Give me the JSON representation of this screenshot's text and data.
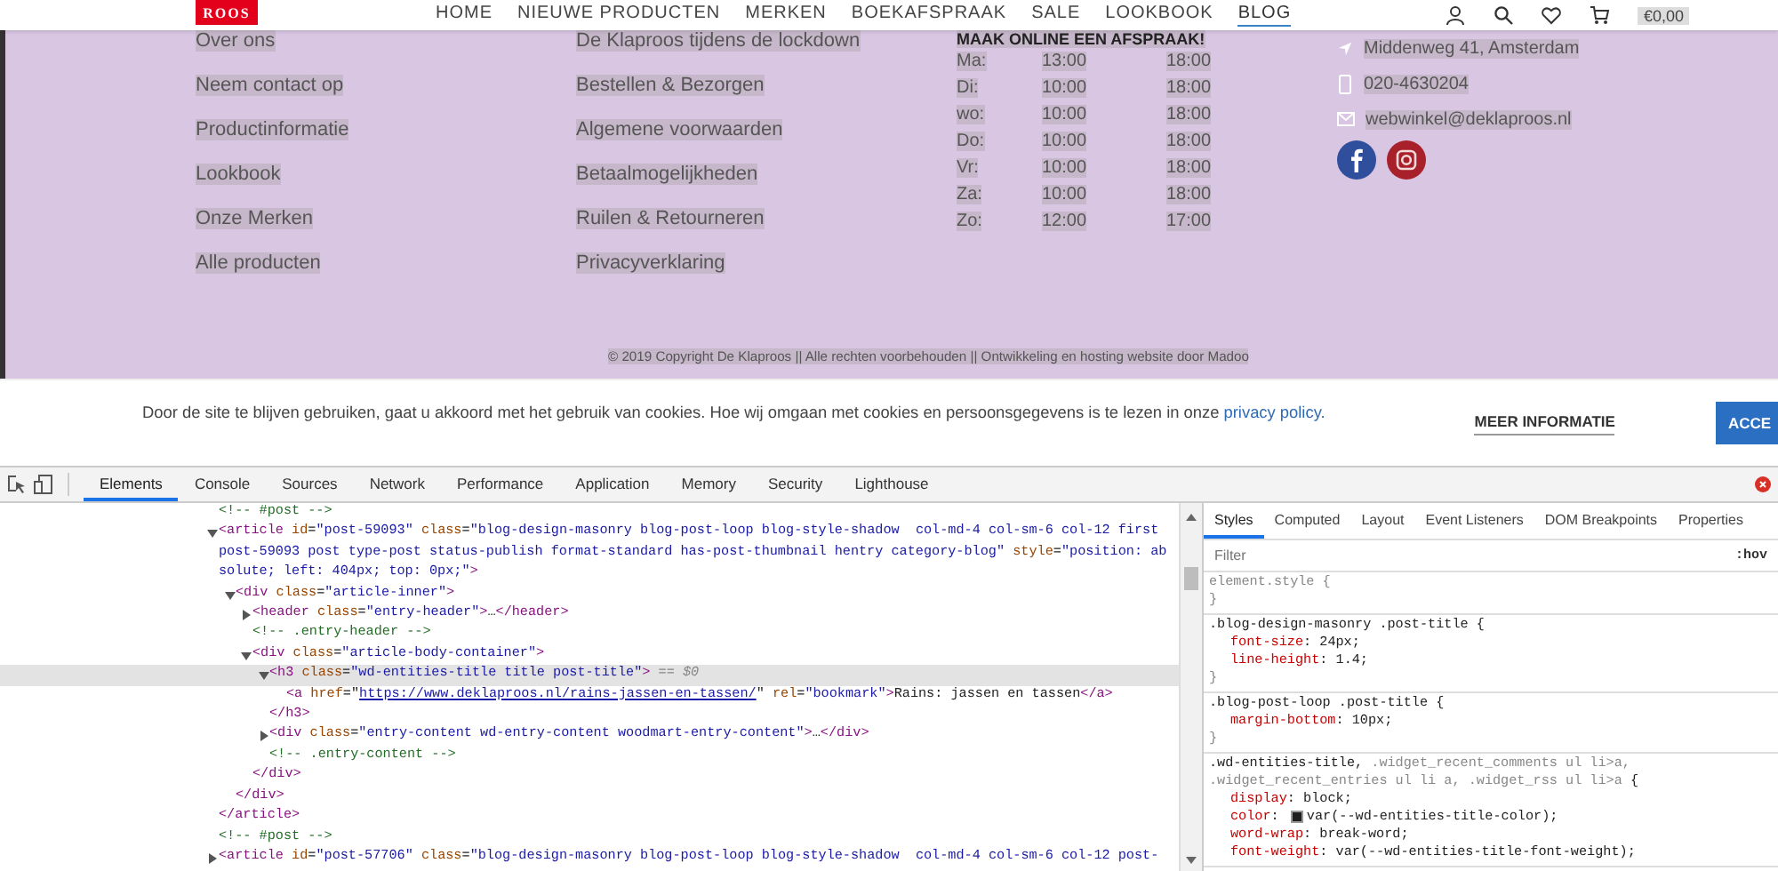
{
  "header": {
    "logo": "ROOS",
    "nav": [
      {
        "label": "HOME",
        "selected": false
      },
      {
        "label": "NIEUWE PRODUCTEN",
        "selected": false
      },
      {
        "label": "MERKEN",
        "selected": false
      },
      {
        "label": "BOEKAFSPRAAK",
        "selected": false
      },
      {
        "label": "SALE",
        "selected": false
      },
      {
        "label": "LOOKBOOK",
        "selected": false
      },
      {
        "label": "BLOG",
        "selected": true
      }
    ],
    "cart_total": "€0,00"
  },
  "footer": {
    "links_1": [
      "Over ons",
      "Neem contact op",
      "Productinformatie",
      "Lookbook",
      "Onze Merken",
      "Alle producten"
    ],
    "links_2": [
      "De Klaproos tijdens de lockdown",
      "Bestellen & Bezorgen",
      "Algemene voorwaarden",
      "Betaalmogelijkheden",
      "Ruilen & Retourneren",
      "Privacyverklaring"
    ],
    "hours": {
      "title": "MAAK ONLINE EEN AFSPRAAK!",
      "rows": [
        {
          "day": "Ma:",
          "open": "13:00",
          "close": "18:00"
        },
        {
          "day": "Di:",
          "open": "10:00",
          "close": "18:00"
        },
        {
          "day": "wo:",
          "open": "10:00",
          "close": "18:00"
        },
        {
          "day": "Do:",
          "open": "10:00",
          "close": "18:00"
        },
        {
          "day": "Vr:",
          "open": "10:00",
          "close": "18:00"
        },
        {
          "day": "Za:",
          "open": "10:00",
          "close": "18:00"
        },
        {
          "day": "Zo:",
          "open": "12:00",
          "close": "17:00"
        }
      ]
    },
    "contact": [
      {
        "kind": "address",
        "text": "Middenweg 41, Amsterdam"
      },
      {
        "kind": "phone",
        "text": "020-4630204"
      },
      {
        "kind": "email",
        "text": "webwinkel@deklaproos.nl"
      }
    ],
    "social": [
      {
        "kind": "facebook"
      },
      {
        "kind": "instagram"
      }
    ],
    "copyright": "© 2019 Copyright De Klaproos || Alle rechten voorbehouden || Ontwikkeling en hosting website door Madoo"
  },
  "cookie_bar": {
    "text": "Door de site te blijven gebruiken, gaat u akkoord met het gebruik van cookies. Hoe wij omgaan met cookies en persoonsgegevens is te lezen in onze ",
    "link": "privacy policy.",
    "more_button": "MEER INFORMATIE",
    "accept_button": "ACCE"
  },
  "devtools": {
    "tabs": [
      {
        "label": "Elements",
        "selected": true
      },
      {
        "label": "Console",
        "selected": false
      },
      {
        "label": "Sources",
        "selected": false
      },
      {
        "label": "Network",
        "selected": false
      },
      {
        "label": "Performance",
        "selected": false
      },
      {
        "label": "Application",
        "selected": false
      },
      {
        "label": "Memory",
        "selected": false
      },
      {
        "label": "Security",
        "selected": false
      },
      {
        "label": "Lighthouse",
        "selected": false
      }
    ],
    "elements": {
      "nodes": [
        {
          "selected": false,
          "tokens": [
            {
              "kind": "comment",
              "text": "<!-- #post -->"
            }
          ]
        },
        {
          "selected": false,
          "expanded": true,
          "tokens": [
            {
              "kind": "tag",
              "text": "<article "
            },
            {
              "kind": "attr",
              "text": "id"
            },
            {
              "kind": "text",
              "text": "="
            },
            {
              "kind": "value",
              "text": "\"post-59093\" "
            },
            {
              "kind": "attr",
              "text": "class"
            },
            {
              "kind": "text",
              "text": "="
            },
            {
              "kind": "value",
              "text": "\"blog-design-masonry blog-post-loop blog-style-shadow  col-md-4 col-sm-6 col-12 first post-59093 post type-post status-publish format-standard has-post-thumbnail hentry category-blog\" "
            },
            {
              "kind": "attr",
              "text": "style"
            },
            {
              "kind": "text",
              "text": "="
            },
            {
              "kind": "value",
              "text": "\"position: absolute; left: 404px; top: 0px;\""
            },
            {
              "kind": "tag",
              "text": ">"
            }
          ],
          "children": [
            {
              "selected": false,
              "expanded": true,
              "tokens": [
                {
                  "kind": "tag",
                  "text": "<div "
                },
                {
                  "kind": "attr",
                  "text": "class"
                },
                {
                  "kind": "text",
                  "text": "="
                },
                {
                  "kind": "value",
                  "text": "\"article-inner\""
                },
                {
                  "kind": "tag",
                  "text": ">"
                }
              ],
              "children": [
                {
                  "selected": false,
                  "expanded": false,
                  "tokens": [
                    {
                      "kind": "tag",
                      "text": "<header "
                    },
                    {
                      "kind": "attr",
                      "text": "class"
                    },
                    {
                      "kind": "text",
                      "text": "="
                    },
                    {
                      "kind": "value",
                      "text": "\"entry-header\""
                    },
                    {
                      "kind": "tag",
                      "text": ">"
                    },
                    {
                      "kind": "text",
                      "text": "…"
                    },
                    {
                      "kind": "tag",
                      "text": "</header>"
                    }
                  ]
                },
                {
                  "selected": false,
                  "tokens": [
                    {
                      "kind": "comment",
                      "text": "<!-- .entry-header -->"
                    }
                  ]
                },
                {
                  "selected": false,
                  "expanded": true,
                  "tokens": [
                    {
                      "kind": "tag",
                      "text": "<div "
                    },
                    {
                      "kind": "attr",
                      "text": "class"
                    },
                    {
                      "kind": "text",
                      "text": "="
                    },
                    {
                      "kind": "value",
                      "text": "\"article-body-container\""
                    },
                    {
                      "kind": "tag",
                      "text": ">"
                    }
                  ],
                  "children": [
                    {
                      "selected": true,
                      "expanded": true,
                      "tokens": [
                        {
                          "kind": "tag",
                          "text": "<h3 "
                        },
                        {
                          "kind": "attr",
                          "text": "class"
                        },
                        {
                          "kind": "text",
                          "text": "="
                        },
                        {
                          "kind": "value",
                          "text": "\"wd-entities-title title post-title\""
                        },
                        {
                          "kind": "tag",
                          "text": ">"
                        },
                        {
                          "kind": "muted",
                          "text": " == $0"
                        }
                      ],
                      "children": [
                        {
                          "selected": false,
                          "tokens": [
                            {
                              "kind": "tag",
                              "text": "<a "
                            },
                            {
                              "kind": "attr",
                              "text": "href"
                            },
                            {
                              "kind": "text",
                              "text": "=\""
                            },
                            {
                              "kind": "link",
                              "text": "https://www.deklaproos.nl/rains-jassen-en-tassen/"
                            },
                            {
                              "kind": "text",
                              "text": "\" "
                            },
                            {
                              "kind": "attr",
                              "text": "rel"
                            },
                            {
                              "kind": "text",
                              "text": "="
                            },
                            {
                              "kind": "value",
                              "text": "\"bookmark\""
                            },
                            {
                              "kind": "tag",
                              "text": ">"
                            },
                            {
                              "kind": "text",
                              "text": "Rains: jassen en tassen"
                            },
                            {
                              "kind": "tag",
                              "text": "</a>"
                            }
                          ]
                        }
                      ],
                      "close": [
                        {
                          "kind": "tag",
                          "text": "</h3>"
                        }
                      ]
                    },
                    {
                      "selected": false,
                      "expanded": false,
                      "tokens": [
                        {
                          "kind": "tag",
                          "text": "<div "
                        },
                        {
                          "kind": "attr",
                          "text": "class"
                        },
                        {
                          "kind": "text",
                          "text": "="
                        },
                        {
                          "kind": "value",
                          "text": "\"entry-content wd-entry-content woodmart-entry-content\""
                        },
                        {
                          "kind": "tag",
                          "text": ">"
                        },
                        {
                          "kind": "text",
                          "text": "…"
                        },
                        {
                          "kind": "tag",
                          "text": "</div>"
                        }
                      ]
                    },
                    {
                      "selected": false,
                      "tokens": [
                        {
                          "kind": "comment",
                          "text": "<!-- .entry-content -->"
                        }
                      ]
                    }
                  ],
                  "close": [
                    {
                      "kind": "tag",
                      "text": "</div>"
                    }
                  ]
                }
              ],
              "close": [
                {
                  "kind": "tag",
                  "text": "</div>"
                }
              ]
            }
          ],
          "close": [
            {
              "kind": "tag",
              "text": "</article>"
            }
          ]
        },
        {
          "selected": false,
          "tokens": [
            {
              "kind": "comment",
              "text": "<!-- #post -->"
            }
          ]
        },
        {
          "selected": false,
          "expanded": false,
          "tokens": [
            {
              "kind": "tag",
              "text": "<article "
            },
            {
              "kind": "attr",
              "text": "id"
            },
            {
              "kind": "text",
              "text": "="
            },
            {
              "kind": "value",
              "text": "\"post-57706\" "
            },
            {
              "kind": "attr",
              "text": "class"
            },
            {
              "kind": "text",
              "text": "="
            },
            {
              "kind": "value",
              "text": "\"blog-design-masonry blog-post-loop blog-style-shadow  col-md-4 col-sm-6 col-12 post-"
            }
          ]
        }
      ]
    },
    "styles": {
      "tabs": [
        {
          "label": "Styles",
          "selected": true
        },
        {
          "label": "Computed",
          "selected": false
        },
        {
          "label": "Layout",
          "selected": false
        },
        {
          "label": "Event Listeners",
          "selected": false
        },
        {
          "label": "DOM Breakpoints",
          "selected": false
        },
        {
          "label": "Properties",
          "selected": false
        }
      ],
      "filter": {
        "placeholder": "Filter"
      },
      "hov": ":hov",
      "rules": [
        {
          "selector_lines": [
            [
              {
                "kind": "plain",
                "text": "element.style {"
              }
            ]
          ],
          "close": "}"
        },
        {
          "selector_lines": [
            [
              {
                "kind": "match",
                "text": ".blog-design-masonry .post-title {"
              }
            ]
          ],
          "declarations": [
            {
              "name": "font-size",
              "colon": ":",
              "value": "24px;"
            },
            {
              "name": "line-height",
              "colon": ":",
              "value": "1.4;"
            }
          ],
          "close": "}"
        },
        {
          "selector_lines": [
            [
              {
                "kind": "match",
                "text": ".blog-post-loop .post-title {"
              }
            ]
          ],
          "declarations": [
            {
              "name": "margin-bottom",
              "colon": ":",
              "value": "10px;"
            }
          ],
          "close": "}"
        },
        {
          "selector_lines": [
            [
              {
                "kind": "match",
                "text": ".wd-entities-title, "
              },
              {
                "kind": "nomatch",
                "text": ".widget_recent_comments ul li>a,"
              }
            ],
            [
              {
                "kind": "nomatch",
                "text": ".widget_recent_entries ul li a, .widget_rss ul li>a "
              },
              {
                "kind": "match",
                "text": "{"
              }
            ]
          ],
          "declarations": [
            {
              "name": "display",
              "colon": ":",
              "value": "block;"
            },
            {
              "name": "color",
              "colon": ":",
              "color": "#1e1e1e",
              "value": "var(--wd-entities-title-color);"
            },
            {
              "name": "word-wrap",
              "colon": ":",
              "value": "break-word;"
            },
            {
              "name": "font-weight",
              "colon": ":",
              "value": "var(--wd-entities-title-font-weight);"
            }
          ]
        }
      ]
    }
  }
}
